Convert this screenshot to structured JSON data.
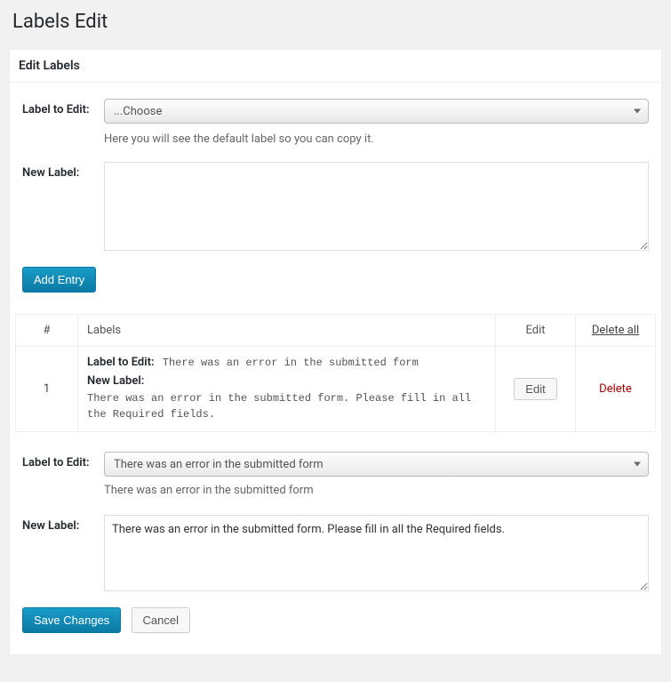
{
  "page_title": "Labels Edit",
  "panel": {
    "title": "Edit Labels"
  },
  "upper_form": {
    "label_to_edit_label": "Label to Edit:",
    "select_placeholder": "...Choose",
    "hint": "Here you will see the default label so you can copy it.",
    "new_label_label": "New Label:",
    "textarea_value": "",
    "add_entry_button": "Add Entry"
  },
  "table": {
    "headers": {
      "num": "#",
      "labels": "Labels",
      "edit": "Edit",
      "delete_all": "Delete all"
    },
    "rows": [
      {
        "num": "1",
        "label_to_edit_key": "Label to Edit:",
        "label_to_edit_value": "There was an error in the submitted form",
        "new_label_key": "New Label:",
        "new_label_value": "There was an error in the submitted form. Please fill in all the Required fields.",
        "edit_button": "Edit",
        "delete_link": "Delete"
      }
    ]
  },
  "lower_form": {
    "label_to_edit_label": "Label to Edit:",
    "select_value": "There was an error in the submitted form",
    "hint": "There was an error in the submitted form",
    "new_label_label": "New Label:",
    "textarea_value": "There was an error in the submitted form. Please fill in all the Required fields."
  },
  "bottom_actions": {
    "save": "Save Changes",
    "cancel": "Cancel"
  }
}
